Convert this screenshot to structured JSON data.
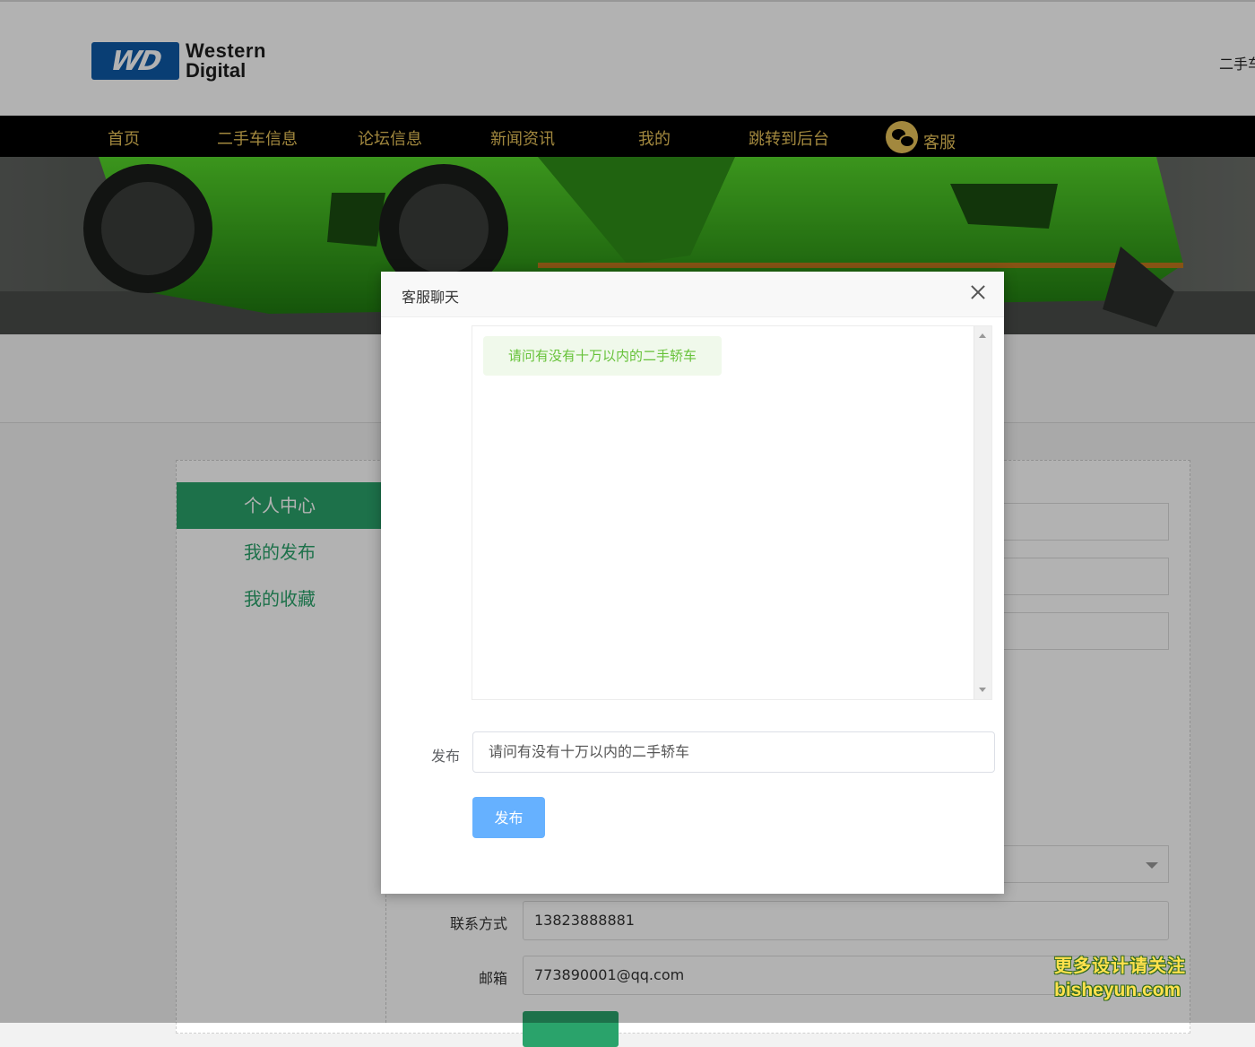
{
  "header": {
    "logo_mark": "WD",
    "logo_line1": "Western",
    "logo_line2": "Digital",
    "right_text": "二手车"
  },
  "nav": {
    "items": [
      {
        "label": "首页"
      },
      {
        "label": "二手车信息"
      },
      {
        "label": "论坛信息"
      },
      {
        "label": "新闻资讯"
      },
      {
        "label": "我的"
      },
      {
        "label": "跳转到后台"
      }
    ],
    "service_label": "客服"
  },
  "sidebar": {
    "items": [
      {
        "label": "个人中心",
        "active": true
      },
      {
        "label": "我的发布"
      },
      {
        "label": "我的收藏"
      }
    ]
  },
  "form": {
    "contact_label": "联系方式",
    "contact_value": "13823888881",
    "email_label": "邮箱",
    "email_value": "773890001@qq.com"
  },
  "modal": {
    "title": "客服聊天",
    "messages": [
      {
        "text": "请问有没有十万以内的二手轿车"
      }
    ],
    "publish_label": "发布",
    "publish_value": "请问有没有十万以内的二手轿车",
    "publish_button": "发布"
  },
  "watermark": {
    "line1": "更多设计请关注",
    "line2": "bisheyun.com"
  },
  "colors": {
    "accent_green": "#2aa36b",
    "nav_gold": "#e8c35a",
    "button_blue": "#66b1ff",
    "bubble_green": "#67c23a"
  }
}
